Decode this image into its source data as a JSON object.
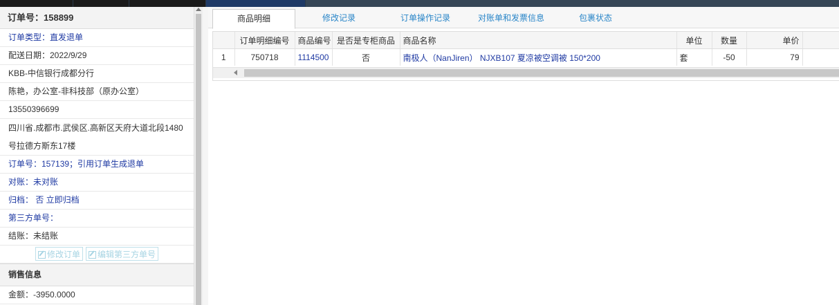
{
  "order_panel": {
    "header": "订单号：158899",
    "order_type": "订单类型：直发退单",
    "delivery_date": "配送日期：2022/9/29",
    "customer": "KBB-中信银行成都分行",
    "contact": "陈艳，办公室-非科技部（原办公室）",
    "phone": "13550396699",
    "address": "四川省.成都市.武侯区.高新区天府大道北段1480号拉德方斯东17楼",
    "ref_order": "订单号：157139；引用订单生成退单",
    "reconcile": "对账：未对账",
    "archive": "归档： 否 立即归档",
    "third_party": "第三方单号：",
    "settlement": "结账：未结账",
    "edit_order_btn": "修改订单",
    "edit_third_btn": "编辑第三方单号"
  },
  "sales_section": {
    "header": "销售信息",
    "amount": "金额：-3950.0000"
  },
  "tabs": [
    {
      "label": "商品明细",
      "active": true
    },
    {
      "label": "修改记录",
      "active": false
    },
    {
      "label": "订单操作记录",
      "active": false
    },
    {
      "label": "对账单和发票信息",
      "active": false
    },
    {
      "label": "包裹状态",
      "active": false
    }
  ],
  "grid": {
    "columns": [
      "",
      "订单明细编号",
      "商品编号",
      "是否是专柜商品",
      "商品名称",
      "单位",
      "数量",
      "单价"
    ],
    "rows": [
      {
        "idx": "1",
        "detail_no": "750718",
        "product_no": "1114500",
        "counter": "否",
        "name": "南极人（NanJiren） NJXB107 夏凉被空调被 150*200",
        "unit": "套",
        "qty": "-50",
        "price": "79"
      }
    ]
  },
  "colors": {
    "link": "#1f3aa3",
    "tab_text": "#2a86c8",
    "topbar": "#364656"
  }
}
